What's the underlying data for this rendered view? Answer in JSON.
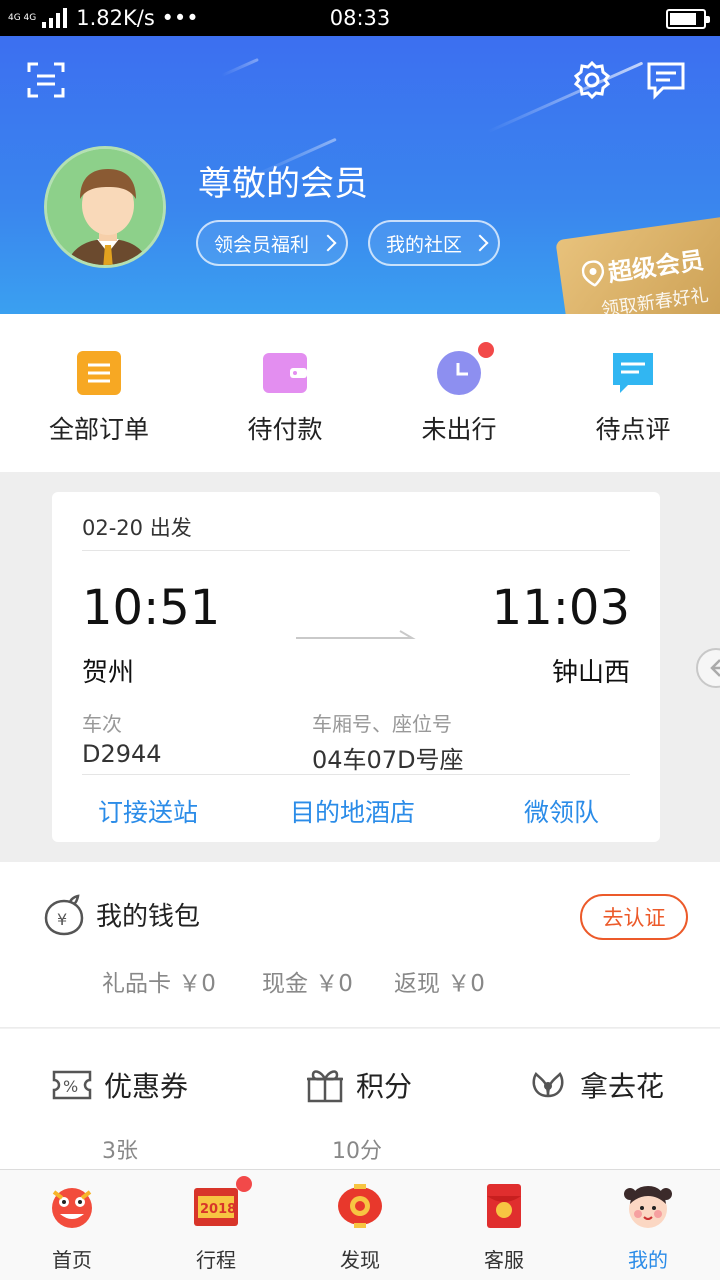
{
  "status_bar": {
    "network": "4G 4G",
    "speed": "1.82K/s •••",
    "time": "08:33"
  },
  "header": {
    "username": "尊敬的会员",
    "benefits_label": "领会员福利",
    "community_label": "我的社区",
    "vip_title": "超级会员",
    "vip_subtitle": "领取新春好礼",
    "icons": [
      "scan-icon",
      "settings-icon",
      "message-icon"
    ]
  },
  "orders": {
    "items": [
      {
        "label": "全部订单",
        "icon": "all-orders-icon",
        "color": "#f7a823"
      },
      {
        "label": "待付款",
        "icon": "wallet-icon",
        "color": "#e38ef0"
      },
      {
        "label": "未出行",
        "icon": "clock-icon",
        "color": "#8d8ff0"
      },
      {
        "label": "待点评",
        "icon": "comment-icon",
        "color": "#31b6f2"
      }
    ]
  },
  "trip": {
    "date": "02-20 出发",
    "dep_time": "10:51",
    "arr_time": "11:03",
    "dep_station": "贺州",
    "arr_station": "钟山西",
    "train_label": "车次",
    "train_no": "D2944",
    "seat_label": "车厢号、座位号",
    "seat_no": "04车07D号座",
    "links": [
      "订接送站",
      "目的地酒店",
      "微领队"
    ]
  },
  "wallet": {
    "title": "我的钱包",
    "verify_label": "去认证",
    "gift_card": "礼品卡 ￥0",
    "cash": "现金 ￥0",
    "cashback": "返现 ￥0"
  },
  "coupons": {
    "coupon_label": "优惠券",
    "coupon_value": "3张",
    "points_label": "积分",
    "points_value": "10分",
    "credit_label": "拿去花"
  },
  "bottom_nav": {
    "items": [
      {
        "label": "首页",
        "icon": "lion-dance-icon"
      },
      {
        "label": "行程",
        "icon": "calendar-2018-icon"
      },
      {
        "label": "发现",
        "icon": "lantern-icon"
      },
      {
        "label": "客服",
        "icon": "red-envelope-icon"
      },
      {
        "label": "我的",
        "icon": "child-face-icon"
      }
    ],
    "active_color": "#2b8ce8"
  }
}
